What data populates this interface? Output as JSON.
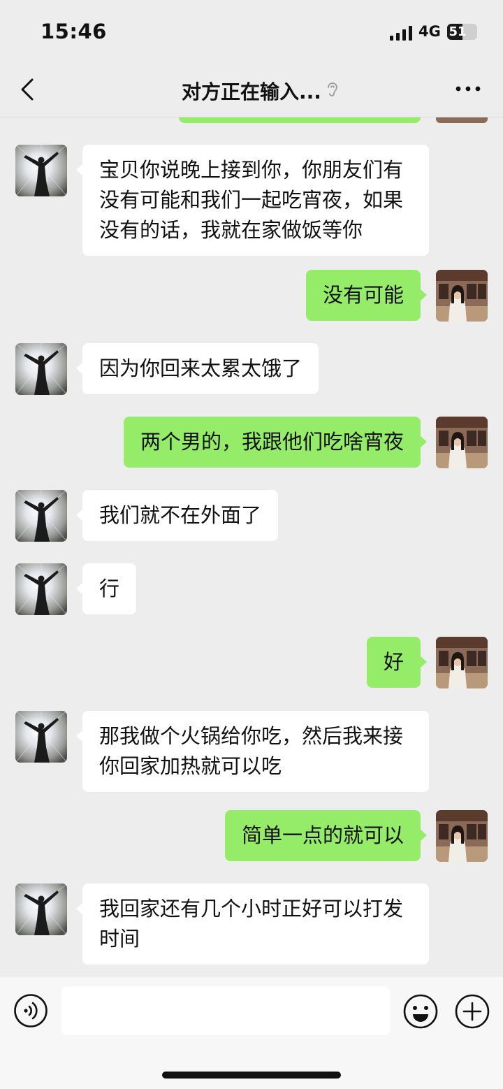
{
  "status_bar": {
    "time": "15:46",
    "network": "4G",
    "battery": "51",
    "battery_level": 0.51
  },
  "nav": {
    "title": "对方正在输入...",
    "back_icon": "chevron-left-icon",
    "earpiece_icon": "ear-icon",
    "more_icon": "more-dots-icon"
  },
  "messages": [
    {
      "side": "left",
      "text": "宝贝你说晚上接到你，你朋友们有没有可能和我们一起吃宵夜，如果没有的话，我就在家做饭等你"
    },
    {
      "side": "right",
      "text": "没有可能"
    },
    {
      "side": "left",
      "text": "因为你回来太累太饿了"
    },
    {
      "side": "right",
      "text": "两个男的，我跟他们吃啥宵夜"
    },
    {
      "side": "left",
      "text": "我们就不在外面了"
    },
    {
      "side": "left",
      "text": "行"
    },
    {
      "side": "right",
      "text": "好"
    },
    {
      "side": "left",
      "text": "那我做个火锅给你吃，然后我来接你回家加热就可以吃"
    },
    {
      "side": "right",
      "text": "简单一点的就可以"
    },
    {
      "side": "left",
      "text": "我回家还有几个小时正好可以打发时间"
    }
  ],
  "input_bar": {
    "voice_icon": "voice-icon",
    "input_value": "",
    "emoji_icon": "emoji-icon",
    "plus_icon": "plus-icon"
  },
  "colors": {
    "background": "#ededed",
    "sent_bubble": "#95ec69",
    "received_bubble": "#ffffff"
  }
}
